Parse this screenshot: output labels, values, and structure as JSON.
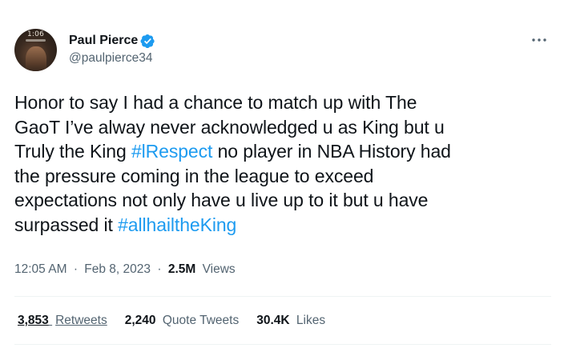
{
  "author": {
    "display_name": "Paul Pierce",
    "handle": "@paulpierce34",
    "avatar_clock": "1:06"
  },
  "tweet": {
    "lines": [
      [
        {
          "text": "Honor to say I had a chance to match up with The"
        }
      ],
      [
        {
          "text": "GaoT I’ve alway never acknowledged u as King but u"
        }
      ],
      [
        {
          "text": "Truly the King "
        },
        {
          "text": "#lRespect",
          "hashtag": true
        },
        {
          "text": " no player in NBA History had"
        }
      ],
      [
        {
          "text": "the pressure coming in the league to exceed"
        }
      ],
      [
        {
          "text": "expectations not only have u live up to it but u have"
        }
      ],
      [
        {
          "text": "surpassed it "
        },
        {
          "text": "#allhailtheKing",
          "hashtag": true
        }
      ]
    ]
  },
  "meta": {
    "time": "12:05 AM",
    "separator": "·",
    "date": "Feb 8, 2023",
    "views_count": "2.5M",
    "views_label": "Views"
  },
  "stats": {
    "retweets_count": "3,853",
    "retweets_label": "Retweets",
    "quotes_count": "2,240",
    "quotes_label": "Quote Tweets",
    "likes_count": "30.4K",
    "likes_label": "Likes"
  },
  "colors": {
    "text": "#0f1419",
    "secondary": "#536471",
    "accent": "#1d9bf0",
    "divider": "#eff3f4"
  },
  "icons": {
    "verified": "verified-badge-icon",
    "more": "more-options-icon"
  }
}
